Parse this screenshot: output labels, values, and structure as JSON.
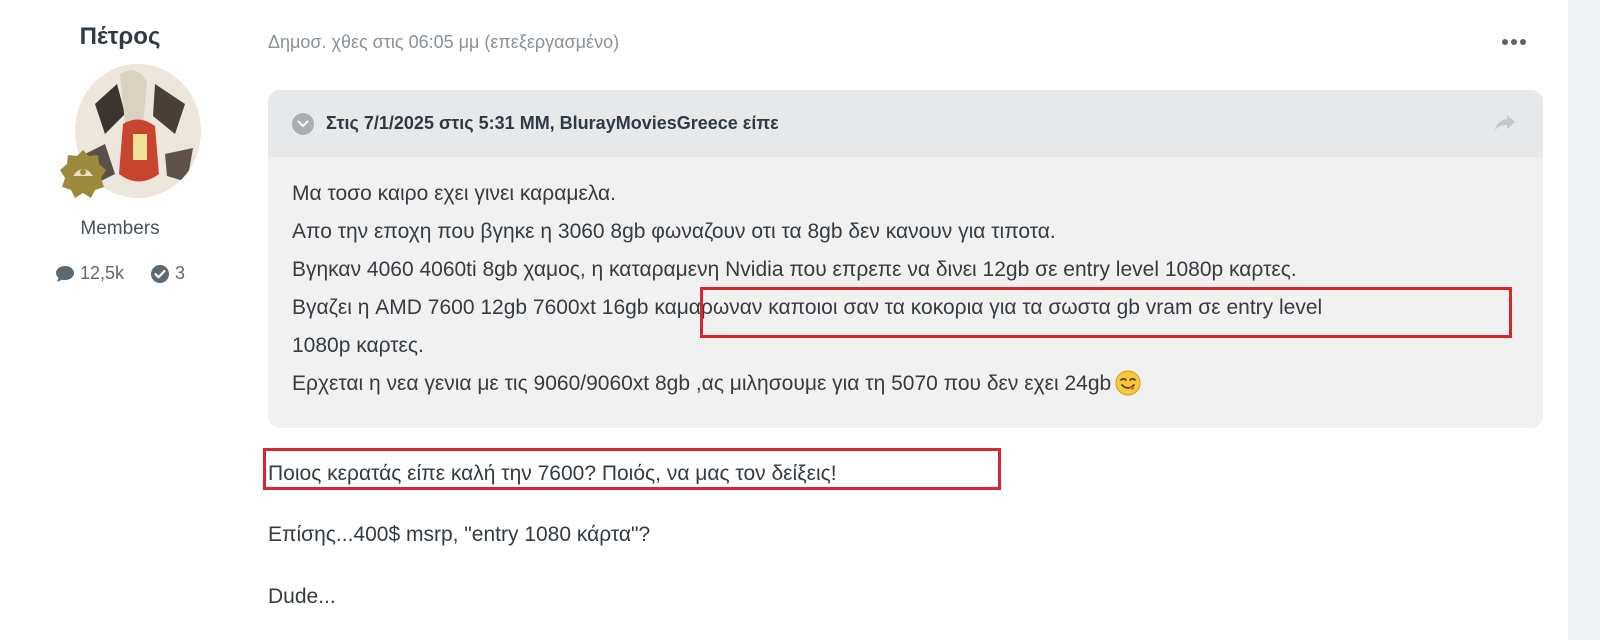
{
  "author": {
    "name": "Πέτρος",
    "group": "Members",
    "stats": {
      "posts": "12,5k",
      "reputation": "3"
    }
  },
  "post": {
    "meta": "Δημοσ. χθες στις 06:05 μμ (επεξεργασμένο)",
    "quote": {
      "citation": "Στις 7/1/2025 στις 5:31 ΜΜ, BlurayMoviesGreece είπε",
      "lines": [
        "Μα τοσο καιρο εχει γινει καραμελα.",
        "Απο την εποχη που βγηκε η 3060 8gb φωναζουν οτι τα 8gb δεν κανουν για τιποτα.",
        "Βγηκαν 4060 4060ti 8gb χαμος, η καταραμενη Nvidia που επρεπε να δινει 12gb σε entry level 1080p καρτες.",
        "Βγαζει η AMD 7600 12gb 7600xt 16gb καμαρωναν καποιοι σαν τα κοκορια για τα σωστα gb vram σε entry level",
        "1080p καρτες.",
        "Ερχεται η νεα γενια με τις 9060/9060xt 8gb ,ας μιλησουμε για τη 5070 που δεν εχει 24gb"
      ]
    },
    "paragraphs": [
      "Ποιος κερατάς είπε καλή την 7600? Ποιός, να μας τον δείξεις!",
      "Επίσης...400$ msrp, \"entry 1080 κάρτα\"?",
      "Dude..."
    ]
  },
  "colors": {
    "highlight": "#d7262f",
    "quote_background": "#f1f1f2",
    "badge": "#9c8a3c"
  },
  "icons": {
    "posts": "comment-icon",
    "reputation": "check-circle-icon",
    "menu": "ellipsis-icon",
    "quote_toggle": "chevron-down-icon",
    "share": "share-arrow-icon",
    "emoji": "yum-face-emoji"
  }
}
